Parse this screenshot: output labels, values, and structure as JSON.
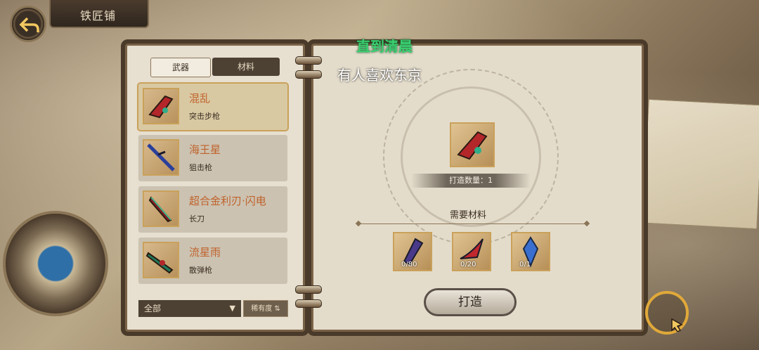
{
  "header": {
    "title": "铁匠铺",
    "back_icon": "back-arrow-icon"
  },
  "overlay_text": {
    "line1": "直到清晨",
    "line2": "有人喜欢东京"
  },
  "tabs": [
    {
      "label": "武器",
      "active": true
    },
    {
      "label": "材料",
      "active": false
    }
  ],
  "items": [
    {
      "name": "混乱",
      "type": "突击步枪",
      "selected": true,
      "icon": "assault-rifle-icon"
    },
    {
      "name": "海王星",
      "type": "狙击枪",
      "selected": false,
      "icon": "sniper-rifle-icon"
    },
    {
      "name": "超合金利刃·闪电",
      "type": "长刀",
      "selected": false,
      "icon": "blade-icon"
    },
    {
      "name": "流星雨",
      "type": "散弹枪",
      "selected": false,
      "icon": "shotgun-icon"
    }
  ],
  "filter": {
    "selected": "全部",
    "sort_label": "稀有度"
  },
  "craft": {
    "quantity_text": "打造数量：1",
    "required_title": "需要材料",
    "materials": [
      {
        "count": "0/80",
        "icon": "material-shard-icon"
      },
      {
        "count": "0/20",
        "icon": "material-blade-icon"
      },
      {
        "count": "0/1",
        "icon": "crystal-icon"
      }
    ],
    "forge_label": "打造"
  },
  "colors": {
    "accent": "#c9a15a",
    "item_name": "#c0622b",
    "overlay_green": "#3ad070"
  }
}
